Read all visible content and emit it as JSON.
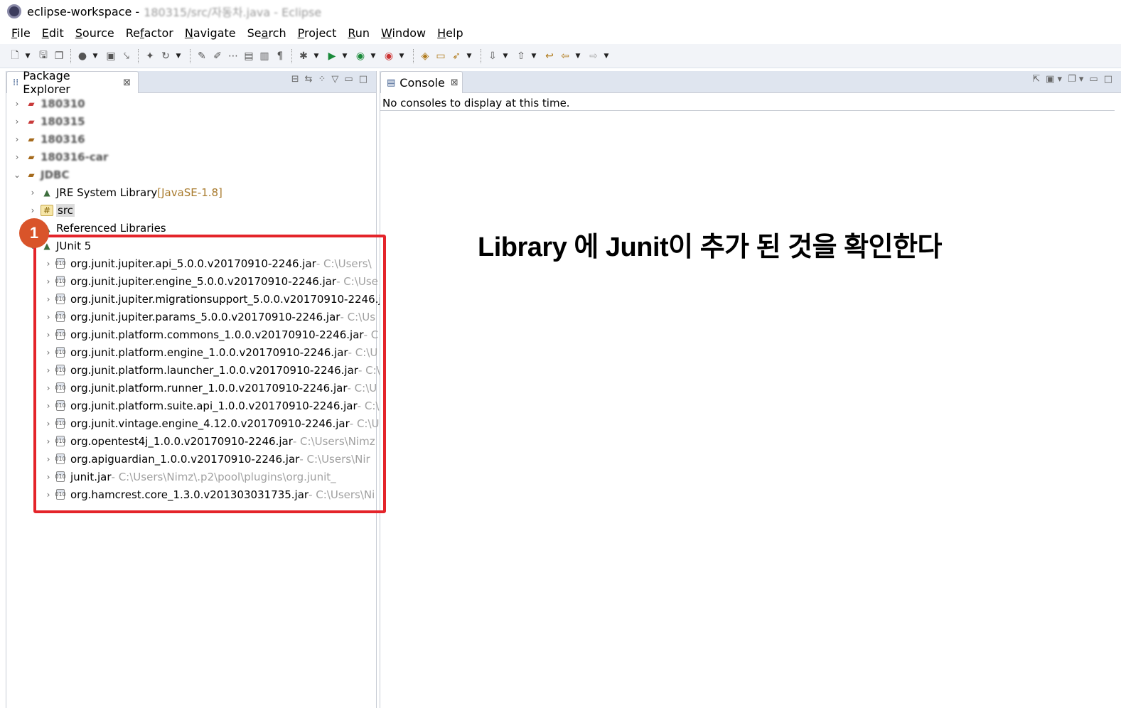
{
  "window": {
    "title": "eclipse-workspace - ",
    "title_path": "180315/src/자동차.java - Eclipse"
  },
  "menu": [
    "File",
    "Edit",
    "Source",
    "Refactor",
    "Navigate",
    "Search",
    "Project",
    "Run",
    "Window",
    "Help"
  ],
  "menu_mnemonics": [
    "F",
    "E",
    "S",
    "f",
    "N",
    "a",
    "P",
    "R",
    "W",
    "H"
  ],
  "package_explorer": {
    "tab_label": "Package Explorer",
    "close_symbol": "⊠",
    "projects": [
      {
        "name": "180310",
        "expanded": false,
        "error": true
      },
      {
        "name": "180315",
        "expanded": false,
        "error": true
      },
      {
        "name": "180316",
        "expanded": false,
        "error": false
      },
      {
        "name": "180316-car",
        "expanded": false,
        "error": false
      },
      {
        "name": "JDBC",
        "expanded": true,
        "error": false
      }
    ],
    "jdbc_children": {
      "jre_label": "JRE System Library",
      "jre_tag": "[JavaSE-1.8]",
      "src_label": "src",
      "referenced_libraries": "Referenced Libraries",
      "junit_label": "JUnit 5"
    },
    "junit_jars": [
      {
        "name": "org.junit.jupiter.api_5.0.0.v20170910-2246.jar",
        "path": " - C:\\Users\\"
      },
      {
        "name": "org.junit.jupiter.engine_5.0.0.v20170910-2246.jar",
        "path": " - C:\\Use"
      },
      {
        "name": "org.junit.jupiter.migrationsupport_5.0.0.v20170910-2246.ja",
        "path": ""
      },
      {
        "name": "org.junit.jupiter.params_5.0.0.v20170910-2246.jar",
        "path": " - C:\\Us"
      },
      {
        "name": "org.junit.platform.commons_1.0.0.v20170910-2246.jar",
        "path": " - C:"
      },
      {
        "name": "org.junit.platform.engine_1.0.0.v20170910-2246.jar",
        "path": " - C:\\U"
      },
      {
        "name": "org.junit.platform.launcher_1.0.0.v20170910-2246.jar",
        "path": " - C:\\"
      },
      {
        "name": "org.junit.platform.runner_1.0.0.v20170910-2246.jar",
        "path": " - C:\\U"
      },
      {
        "name": "org.junit.platform.suite.api_1.0.0.v20170910-2246.jar",
        "path": " - C:\\"
      },
      {
        "name": "org.junit.vintage.engine_4.12.0.v20170910-2246.jar",
        "path": " - C:\\U"
      },
      {
        "name": "org.opentest4j_1.0.0.v20170910-2246.jar",
        "path": " - C:\\Users\\Nimz"
      },
      {
        "name": "org.apiguardian_1.0.0.v20170910-2246.jar",
        "path": " - C:\\Users\\Nir"
      },
      {
        "name": "junit.jar",
        "path": " - C:\\Users\\Nimz\\.p2\\pool\\plugins\\org.junit_"
      },
      {
        "name": "org.hamcrest.core_1.3.0.v201303031735.jar",
        "path": " - C:\\Users\\Ni"
      }
    ]
  },
  "console": {
    "tab_label": "Console",
    "close_symbol": "⊠",
    "message": "No consoles to display at this time."
  },
  "annotation": {
    "badge": "1",
    "caption": "Library 에 Junit이 추가 된 것을 확인한다",
    "color": "#e4242a"
  }
}
